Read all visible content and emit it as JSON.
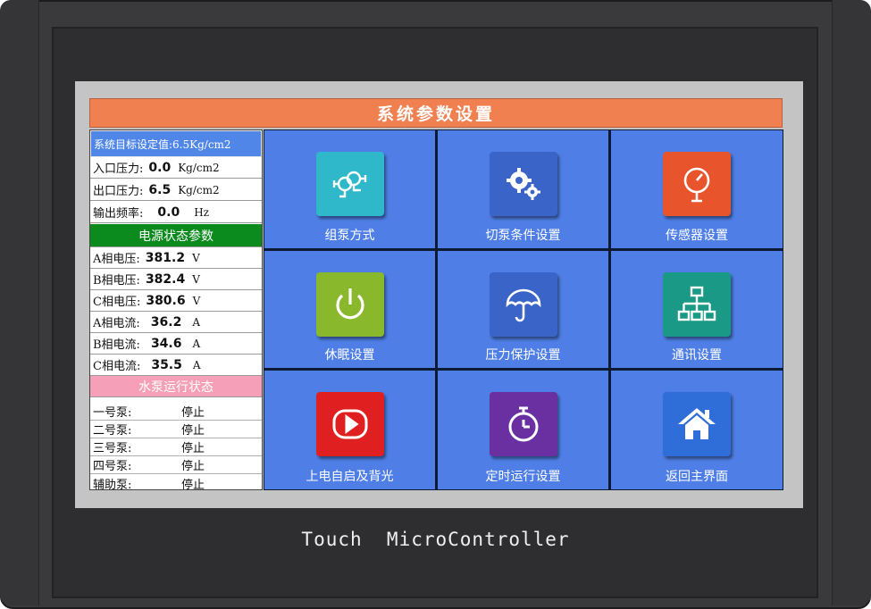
{
  "title": "系统参数设置",
  "target_setting": "系统目标设定值:6.5Kg/cm2",
  "pressure_rows": [
    {
      "label": "入口压力:",
      "value": "0.0",
      "unit": "Kg/cm2"
    },
    {
      "label": "出口压力:",
      "value": "6.5",
      "unit": "Kg/cm2"
    },
    {
      "label": "输出频率:",
      "value": "0.0",
      "unit": "Hz"
    }
  ],
  "power_section_title": "电源状态参数",
  "power_rows": [
    {
      "label": "A相电压:",
      "value": "381.2",
      "unit": "V"
    },
    {
      "label": "B相电压:",
      "value": "382.4",
      "unit": "V"
    },
    {
      "label": "C相电压:",
      "value": "380.6",
      "unit": "V"
    },
    {
      "label": "A相电流:",
      "value": "36.2",
      "unit": "A"
    },
    {
      "label": "B相电流:",
      "value": "34.6",
      "unit": "A"
    },
    {
      "label": "C相电流:",
      "value": "35.5",
      "unit": "A"
    }
  ],
  "pump_section_title": "水泵运行状态",
  "pump_rows": [
    {
      "label": "一号泵:",
      "status": "停止"
    },
    {
      "label": "二号泵:",
      "status": "停止"
    },
    {
      "label": "三号泵:",
      "status": "停止"
    },
    {
      "label": "四号泵:",
      "status": "停止"
    },
    {
      "label": "辅助泵:",
      "status": "停止"
    }
  ],
  "tiles": [
    {
      "label": "组泵方式",
      "icon": "pump-group-icon",
      "color": "#2fb8c9"
    },
    {
      "label": "切泵条件设置",
      "icon": "gears-icon",
      "color": "#3b64c8"
    },
    {
      "label": "传感器设置",
      "icon": "gauge-icon",
      "color": "#e8542c"
    },
    {
      "label": "休眠设置",
      "icon": "power-icon",
      "color": "#8ab82c"
    },
    {
      "label": "压力保护设置",
      "icon": "umbrella-icon",
      "color": "#3b64c8"
    },
    {
      "label": "通讯设置",
      "icon": "network-icon",
      "color": "#1a9a86"
    },
    {
      "label": "上电自启及背光",
      "icon": "play-icon",
      "color": "#e02020"
    },
    {
      "label": "定时运行设置",
      "icon": "stopwatch-icon",
      "color": "#6a2fa0"
    },
    {
      "label": "返回主界面",
      "icon": "home-icon",
      "color": "#2f6ed8"
    }
  ],
  "brand_text": "Touch  MicroController"
}
